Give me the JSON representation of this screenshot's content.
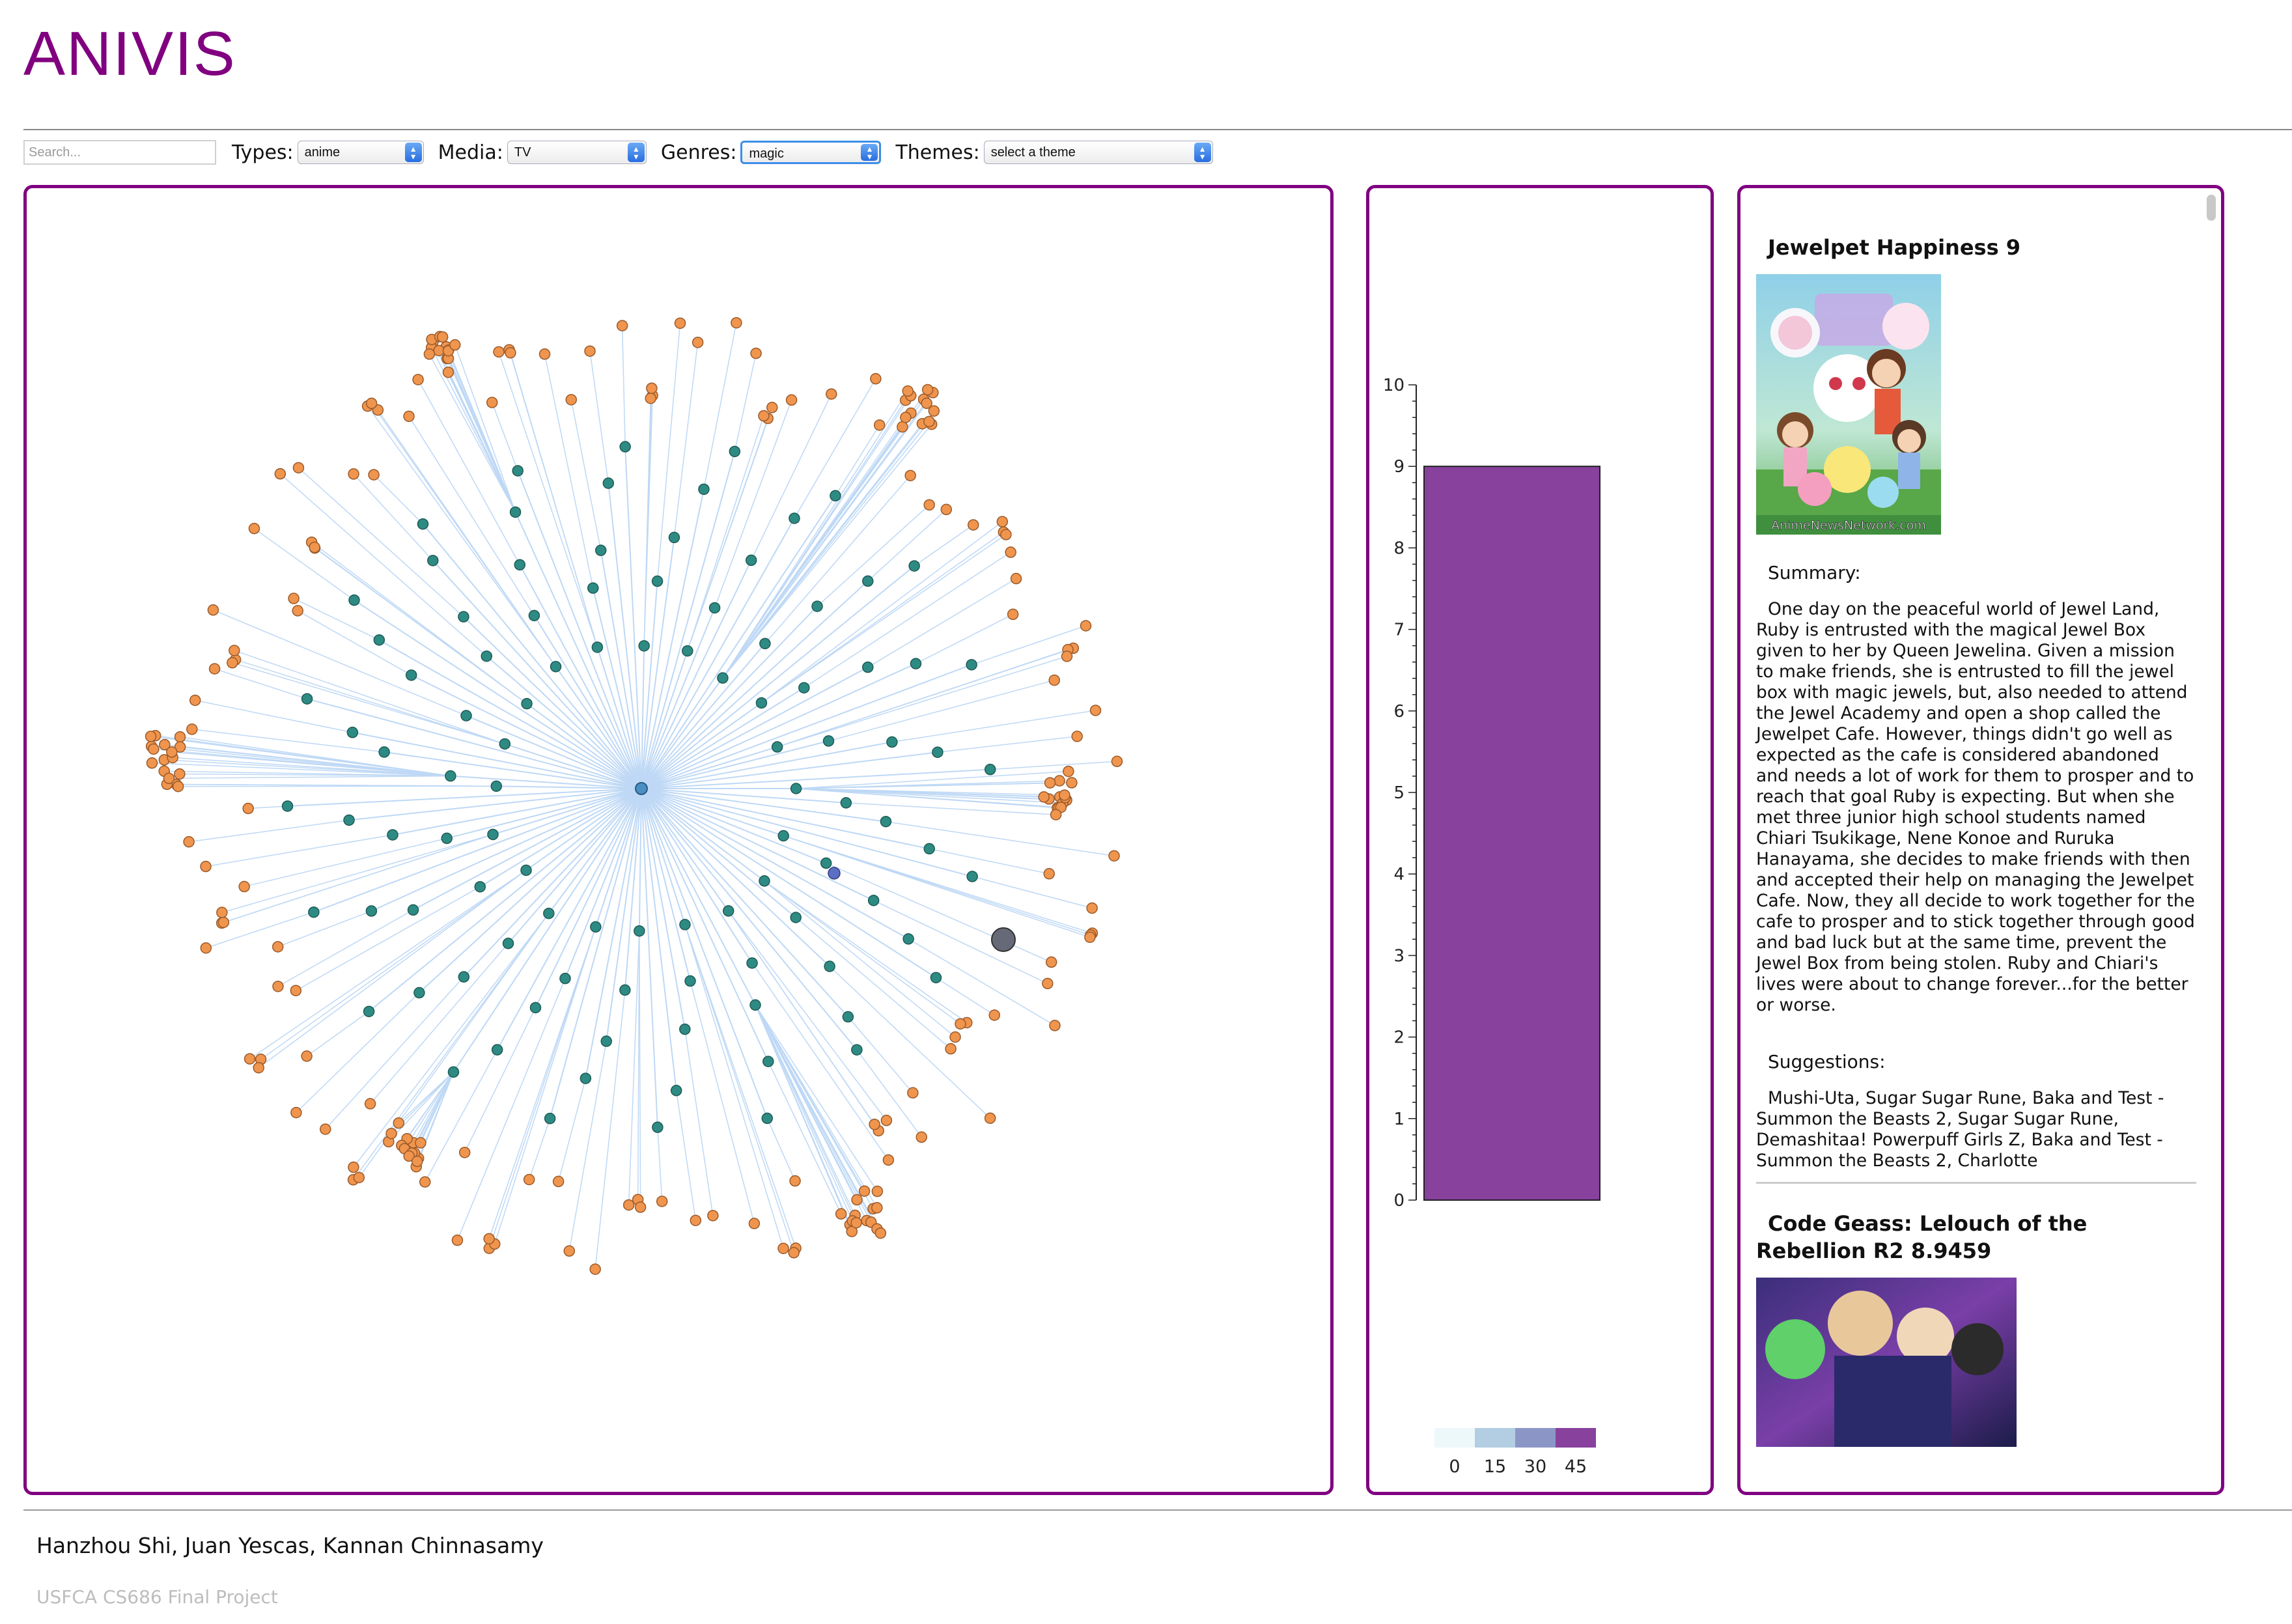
{
  "app": {
    "title": "ANIVIS"
  },
  "filters": {
    "search_placeholder": "Search...",
    "types_label": "Types:",
    "types_value": "anime",
    "media_label": "Media:",
    "media_value": "TV",
    "genres_label": "Genres:",
    "genres_value": "magic",
    "themes_label": "Themes:",
    "themes_value": "select a theme"
  },
  "colors": {
    "brand": "#800080",
    "bar": "#88419d",
    "anime_node": "#2e8b84",
    "related_node": "#f0954e",
    "link": "#bed8f5",
    "center_node": "#4a90c4",
    "highlight_node": "#5b6fc4",
    "large_node": "#666a78"
  },
  "network": {
    "node_types": [
      "center",
      "anime",
      "related",
      "highlight",
      "large"
    ],
    "anime_node_count": 100
  },
  "chart_data": {
    "type": "bar",
    "categories": [
      "Jewelpet Happiness"
    ],
    "values": [
      9
    ],
    "ylim": [
      0,
      10
    ],
    "yticks": [
      0,
      1,
      2,
      3,
      4,
      5,
      6,
      7,
      8,
      9,
      10
    ],
    "legend": {
      "labels": [
        "0",
        "15",
        "30",
        "45"
      ],
      "colors": [
        "#edf8fb",
        "#b3cde3",
        "#8c96c6",
        "#88419d"
      ]
    }
  },
  "details": {
    "items": [
      {
        "title": "Jewelpet Happiness  9",
        "poster_caption": "AnimeNewsNetwork.com",
        "summary_label": "Summary:",
        "summary": "One day on the peaceful world of Jewel Land, Ruby is entrusted with the magical Jewel Box given to her by Queen Jewelina. Given a mission to make friends, she is entrusted to fill the jewel box with magic jewels, but, also needed to attend the Jewel Academy and open a shop called the Jewelpet Cafe. However, things didn't go well as expected as the cafe is considered abandoned and needs a lot of work for them to prosper and to reach that goal Ruby is expecting. But when she met three junior high school students named Chiari Tsukikage, Nene Konoe and Ruruka Hanayama, she decides to make friends with then and accepted their help on managing the Jewelpet Cafe. Now, they all decide to work together for the cafe to prosper and to stick together through good and bad luck but at the same time, prevent the Jewel Box from being stolen. Ruby and Chiari's lives were about to change forever...for the better or worse.",
        "suggestions_label": "Suggestions:",
        "suggestions": "Mushi-Uta, Sugar Sugar Rune, Baka and Test - Summon the Beasts 2, Sugar Sugar Rune, Demashitaa! Powerpuff Girls Z, Baka and Test - Summon the Beasts 2, Charlotte"
      },
      {
        "title": "Code Geass: Lelouch of the Rebellion R2  8.9459"
      }
    ]
  },
  "footer": {
    "authors": "Hanzhou Shi,  Juan Yescas,  Kannan Chinnasamy",
    "course": "USFCA   CS686   Final Project"
  }
}
